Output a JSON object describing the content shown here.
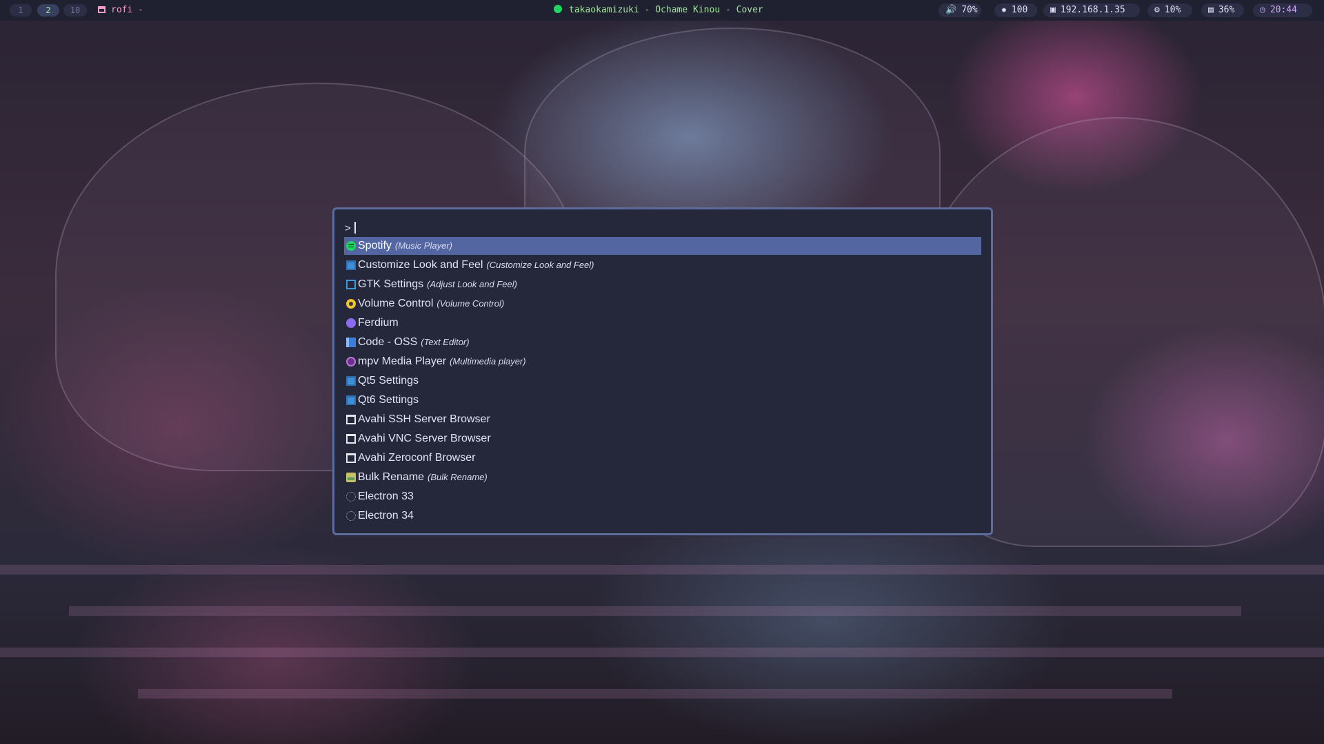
{
  "topbar": {
    "workspaces": [
      "1",
      "2",
      "10"
    ],
    "active_workspace": "2",
    "window_title": "rofi -",
    "now_playing": "takaokamizuki - Ochame Kinou - Cover",
    "volume": {
      "icon": "volume-icon",
      "value": "70%"
    },
    "brightness": {
      "icon": "brightness-icon",
      "value": "100"
    },
    "network": {
      "icon": "network-icon",
      "value": "192.168.1.35"
    },
    "cpu": {
      "icon": "cpu-icon",
      "value": "10%"
    },
    "memory": {
      "icon": "memory-icon",
      "value": "36%"
    },
    "clock": {
      "icon": "clock-icon",
      "value": "20:44"
    }
  },
  "rofi": {
    "prompt": ">",
    "query": "",
    "items": [
      {
        "name": "Spotify",
        "description": "(Music Player)",
        "icon": "spotify-icon",
        "selected": true
      },
      {
        "name": "Customize Look and Feel",
        "description": "(Customize Look and Feel)",
        "icon": "window-icon"
      },
      {
        "name": "GTK Settings",
        "description": "(Adjust Look and Feel)",
        "icon": "settings-icon"
      },
      {
        "name": "Volume Control",
        "description": "(Volume Control)",
        "icon": "volume-icon"
      },
      {
        "name": "Ferdium",
        "description": "",
        "icon": "ferdium-icon"
      },
      {
        "name": "Code - OSS",
        "description": "(Text Editor)",
        "icon": "code-icon"
      },
      {
        "name": "mpv Media Player",
        "description": "(Multimedia player)",
        "icon": "mpv-icon"
      },
      {
        "name": "Qt5 Settings",
        "description": "",
        "icon": "window-icon"
      },
      {
        "name": "Qt6 Settings",
        "description": "",
        "icon": "window-icon"
      },
      {
        "name": "Avahi SSH Server Browser",
        "description": "",
        "icon": "terminal-icon"
      },
      {
        "name": "Avahi VNC Server Browser",
        "description": "",
        "icon": "terminal-icon"
      },
      {
        "name": "Avahi Zeroconf Browser",
        "description": "",
        "icon": "terminal-icon"
      },
      {
        "name": "Bulk Rename",
        "description": "(Bulk Rename)",
        "icon": "rename-icon"
      },
      {
        "name": "Electron 33",
        "description": "",
        "icon": "electron-icon"
      },
      {
        "name": "Electron 34",
        "description": "",
        "icon": "electron-icon"
      }
    ]
  },
  "colors": {
    "bar_bg": "#1f2030",
    "rofi_bg": "#25283a",
    "rofi_border": "#5d6c9c",
    "selected_bg": "#5466a2",
    "accent_green": "#a6e3a1",
    "accent_pink": "#f0a0c8"
  }
}
